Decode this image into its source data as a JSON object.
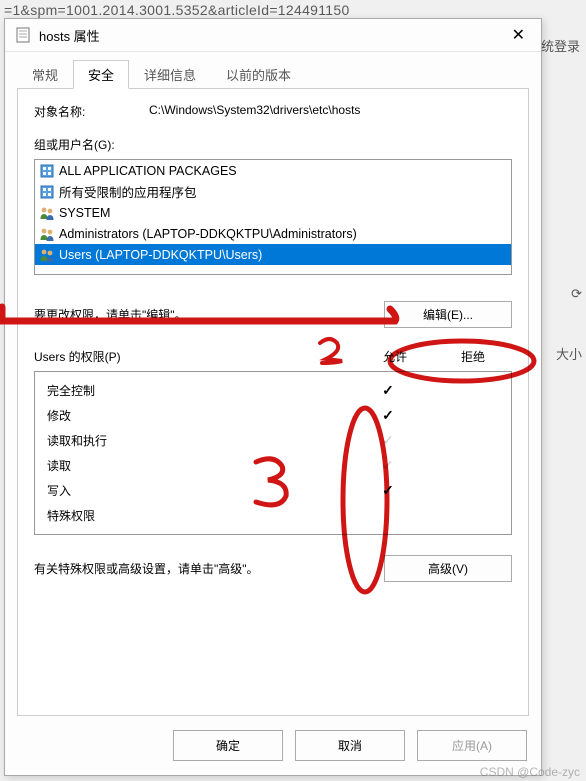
{
  "background": {
    "url_fragment": "=1&spm=1001.2014.3001.5352&articleId=124491150",
    "login": "统登录",
    "label_refresh": "⟳",
    "label_size": "大小"
  },
  "dialog": {
    "title": "hosts 属性",
    "close": "✕",
    "tabs": [
      "常规",
      "安全",
      "详细信息",
      "以前的版本"
    ],
    "active_tab": "安全",
    "object_name_label": "对象名称:",
    "object_name_value": "C:\\Windows\\System32\\drivers\\etc\\hosts",
    "groups_label": "组或用户名(G):",
    "groups": [
      {
        "name": "ALL APPLICATION PACKAGES",
        "icon": "package"
      },
      {
        "name": "所有受限制的应用程序包",
        "icon": "package"
      },
      {
        "name": "SYSTEM",
        "icon": "users"
      },
      {
        "name": "Administrators (LAPTOP-DDKQKTPU\\Administrators)",
        "icon": "users"
      },
      {
        "name": "Users (LAPTOP-DDKQKTPU\\Users)",
        "icon": "users",
        "selected": true
      }
    ],
    "edit_hint": "要更改权限，请单击\"编辑\"。",
    "edit_button": "编辑(E)...",
    "perm_title": "Users 的权限(P)",
    "perm_allow": "允许",
    "perm_deny": "拒绝",
    "permissions": [
      {
        "name": "完全控制",
        "allow": true,
        "deny": false,
        "inactive": false
      },
      {
        "name": "修改",
        "allow": true,
        "deny": false,
        "inactive": false
      },
      {
        "name": "读取和执行",
        "allow": true,
        "deny": false,
        "inactive": true
      },
      {
        "name": "读取",
        "allow": true,
        "deny": false,
        "inactive": true
      },
      {
        "name": "写入",
        "allow": true,
        "deny": false,
        "inactive": false
      },
      {
        "name": "特殊权限",
        "allow": false,
        "deny": false,
        "inactive": false
      }
    ],
    "advanced_hint": "有关特殊权限或高级设置，请单击\"高级\"。",
    "advanced_button": "高级(V)",
    "ok": "确定",
    "cancel": "取消",
    "apply": "应用(A)"
  },
  "watermark": "CSDN @Code-zyc"
}
